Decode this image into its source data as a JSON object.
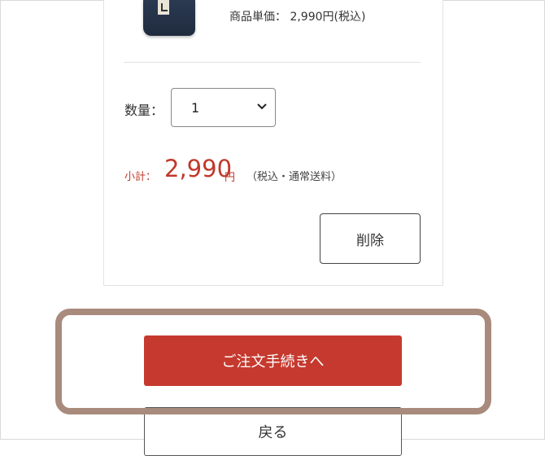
{
  "product": {
    "unit_price_text": "商品単価： 2,990円(税込)",
    "image_icon": "rice-bag-product-image"
  },
  "quantity": {
    "label": "数量：",
    "selected": "1"
  },
  "subtotal": {
    "label": "小計：",
    "value": "2,990",
    "unit": "円",
    "note": "（税込・通常送料）"
  },
  "actions": {
    "delete_label": "削除",
    "checkout_label": "ご注文手続きへ",
    "back_label": "戻る"
  },
  "colors": {
    "accent": "#c5392e",
    "highlight_frame": "#a88b7d"
  }
}
